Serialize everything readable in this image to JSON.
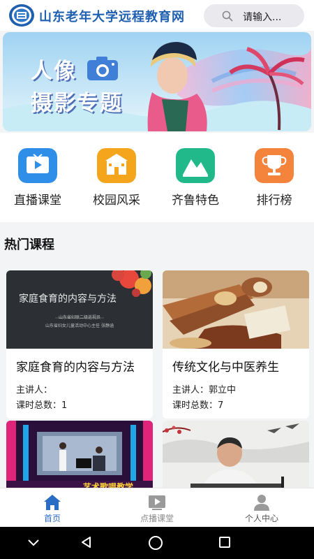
{
  "header": {
    "site_title": "山东老年大学远程教育网",
    "search_placeholder": "请输入...",
    "logo_icon": "university-seal-logo",
    "search_icon": "search-icon"
  },
  "banner": {
    "line1": "人像",
    "line2": "摄影专题",
    "camera_icon": "camera-icon"
  },
  "quick_nav": [
    {
      "label": "直播课堂",
      "icon": "tv-play-icon",
      "color": "#2f8fe8"
    },
    {
      "label": "校园风采",
      "icon": "school-building-icon",
      "color": "#f5a51c"
    },
    {
      "label": "齐鲁特色",
      "icon": "mountain-icon",
      "color": "#21b98a"
    },
    {
      "label": "排行榜",
      "icon": "trophy-icon",
      "color": "#f4833b"
    }
  ],
  "hot_courses": {
    "title": "热门课程",
    "items": [
      {
        "title": "家庭食育的内容与方法",
        "lecturer_label": "主讲人：",
        "lecturer": "",
        "lessons_label": "课时总数：",
        "lessons": "1",
        "thumb_heading": "家庭食育的内容与方法",
        "thumb_sub1": "山东省妇联二级巡视员",
        "thumb_sub2": "山东省妇女儿童活动中心主任  张静涵"
      },
      {
        "title": "传统文化与中医养生",
        "lecturer_label": "主讲人：",
        "lecturer": "郭立中",
        "lessons_label": "课时总数：",
        "lessons": "7",
        "thumb_heading": "",
        "thumb_sub1": "",
        "thumb_sub2": ""
      },
      {
        "title": "",
        "thumb_heading": "艺术歌唱教学",
        "thumb_sub1": "",
        "thumb_sub2": ""
      },
      {
        "title": "",
        "thumb_heading": "",
        "thumb_sub1": "",
        "thumb_sub2": ""
      }
    ]
  },
  "tab_bar": [
    {
      "label": "首页",
      "icon": "home-icon",
      "active": true
    },
    {
      "label": "点播课堂",
      "icon": "video-play-icon",
      "active": false
    },
    {
      "label": "个人中心",
      "icon": "user-icon",
      "active": false
    }
  ],
  "system_nav": [
    "collapse-icon",
    "back-icon",
    "home-circle-icon",
    "recents-icon"
  ],
  "colors": {
    "brand_blue": "#1f5fb0",
    "tab_active": "#2b6cc4",
    "tab_inactive": "#8a8a8a"
  }
}
